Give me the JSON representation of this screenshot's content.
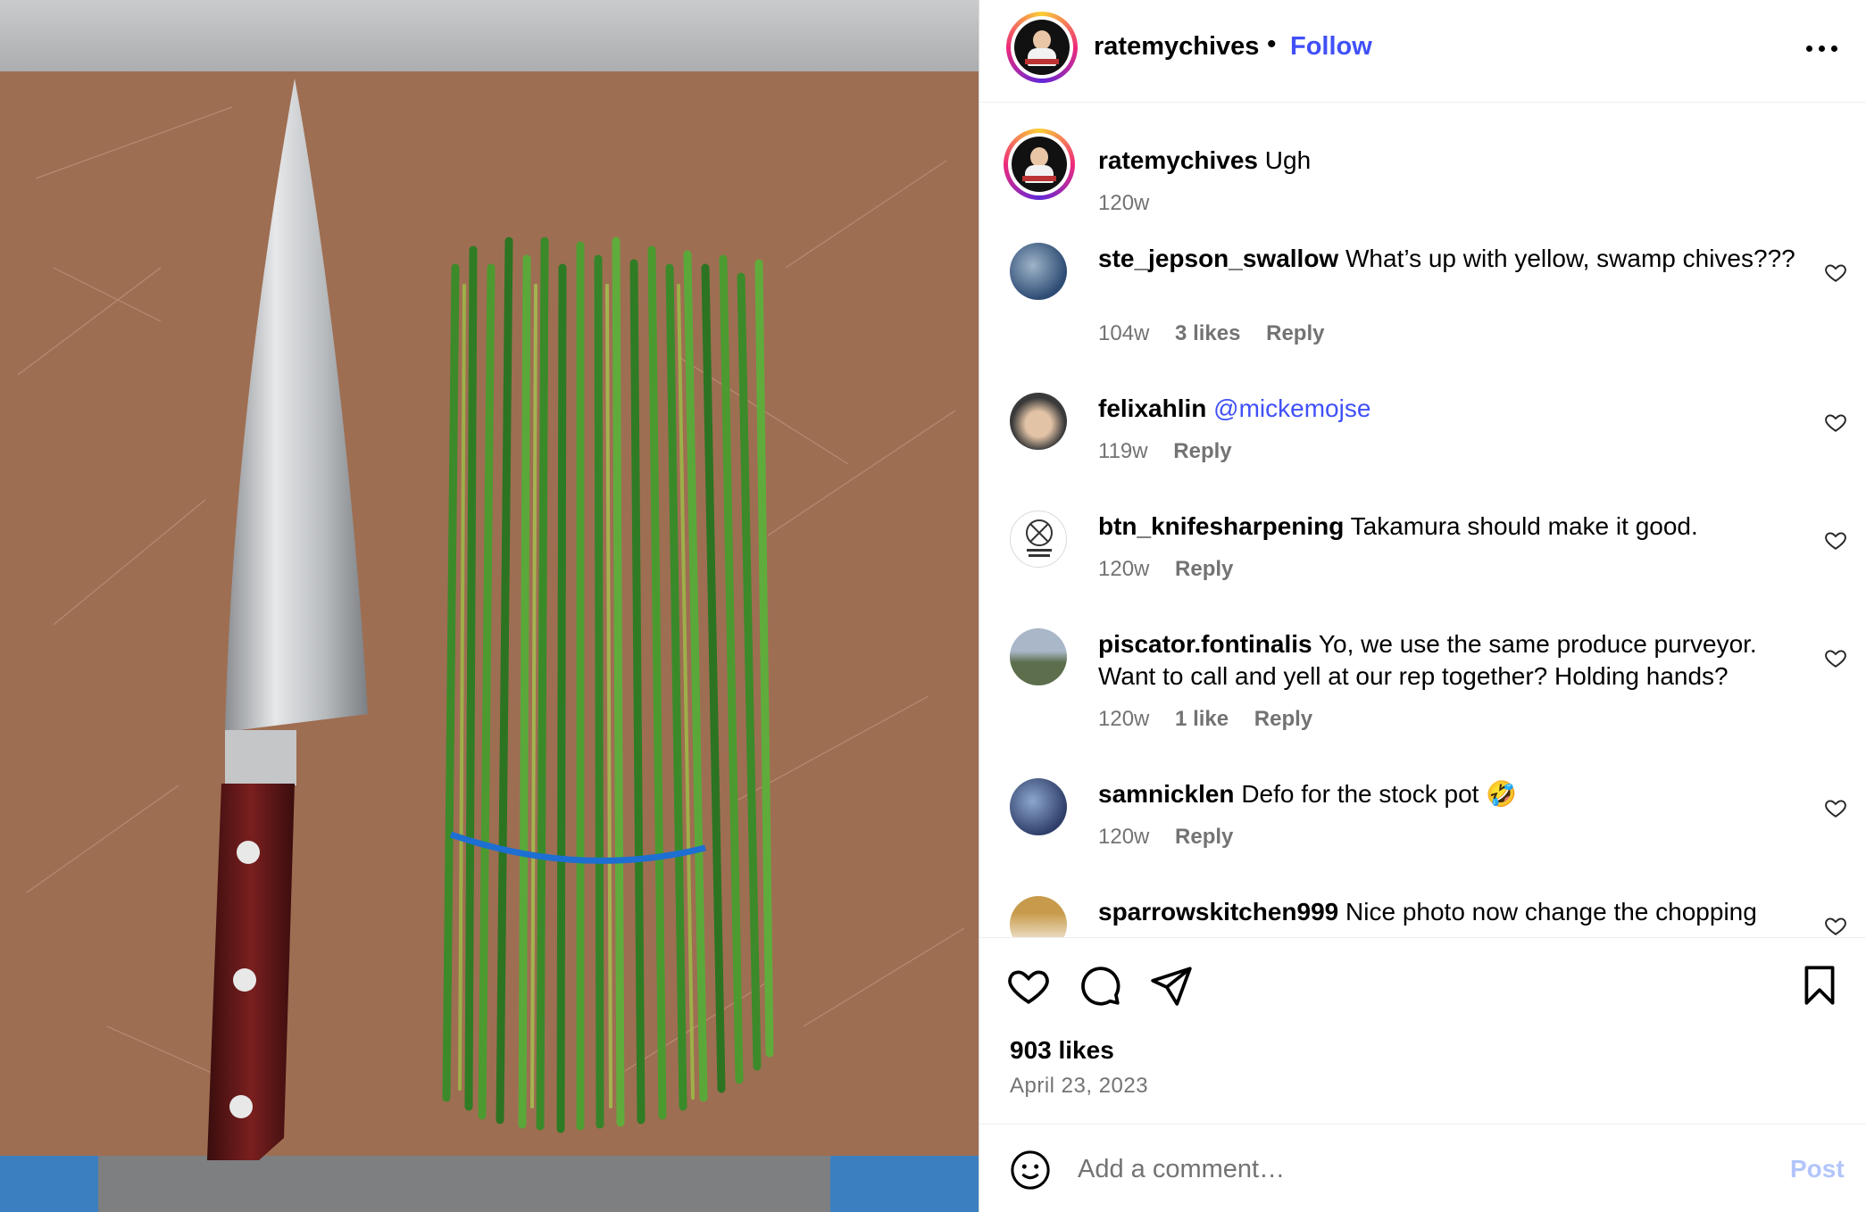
{
  "header": {
    "username": "ratemychives",
    "separator": "•",
    "follow_label": "Follow",
    "more_icon": "more-horizontal-icon"
  },
  "caption": {
    "username": "ratemychives",
    "text": "Ugh",
    "time": "120w"
  },
  "comments": [
    {
      "username": "ste_jepson_swallow",
      "text": "What’s up with yellow, swamp chives???",
      "time": "104w",
      "likes": "3 likes",
      "reply": "Reply"
    },
    {
      "username": "felixahlin",
      "mention": "@mickemojse",
      "time": "119w",
      "reply": "Reply"
    },
    {
      "username": "btn_knifesharpening",
      "text": "Takamura should make it good.",
      "time": "120w",
      "reply": "Reply"
    },
    {
      "username": "piscator.fontinalis",
      "text": "Yo, we use the same produce purveyor. Want to call and yell at our rep together? Holding hands?",
      "time": "120w",
      "likes": "1 like",
      "reply": "Reply"
    },
    {
      "username": "samnicklen",
      "text": "Defo for the stock pot 🤣",
      "time": "120w",
      "reply": "Reply"
    },
    {
      "username": "sparrowskitchen999",
      "text": "Nice photo now change the chopping"
    }
  ],
  "actions": {
    "like_icon": "heart-icon",
    "comment_icon": "comment-icon",
    "share_icon": "send-icon",
    "save_icon": "bookmark-icon"
  },
  "stats": {
    "likes": "903 likes",
    "date": "April 23, 2023"
  },
  "add_comment": {
    "placeholder": "Add a comment…",
    "post_label": "Post"
  },
  "colors": {
    "link_blue": "#4150f7",
    "post_disabled": "#b2c5fb",
    "meta_grey": "#737373",
    "board_brown": "#9e6e52",
    "chive_green": "#3f8f2a"
  }
}
